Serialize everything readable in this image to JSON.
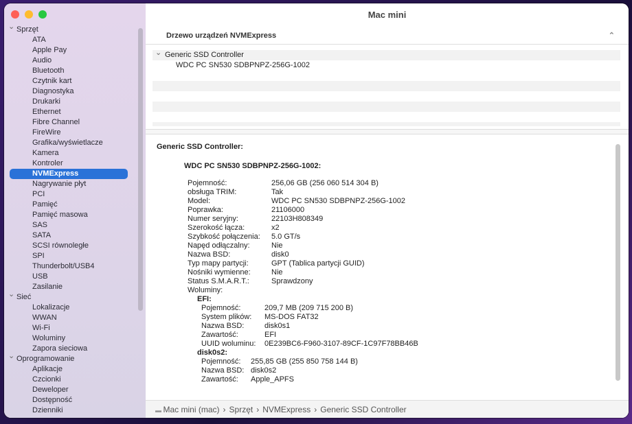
{
  "window": {
    "title": "Mac mini"
  },
  "sidebar": {
    "groups": [
      {
        "label": "Sprzęt",
        "items": [
          "ATA",
          "Apple Pay",
          "Audio",
          "Bluetooth",
          "Czytnik kart",
          "Diagnostyka",
          "Drukarki",
          "Ethernet",
          "Fibre Channel",
          "FireWire",
          "Grafika/wyświetlacze",
          "Kamera",
          "Kontroler",
          "NVMExpress",
          "Nagrywanie płyt",
          "PCI",
          "Pamięć",
          "Pamięć masowa",
          "SAS",
          "SATA",
          "SCSI równoległe",
          "SPI",
          "Thunderbolt/USB4",
          "USB",
          "Zasilanie"
        ]
      },
      {
        "label": "Sieć",
        "items": [
          "Lokalizacje",
          "WWAN",
          "Wi-Fi",
          "Woluminy",
          "Zapora sieciowa"
        ]
      },
      {
        "label": "Oprogramowanie",
        "items": [
          "Aplikacje",
          "Czcionki",
          "Deweloper",
          "Dostępność",
          "Dzienniki"
        ]
      }
    ],
    "selected": "NVMExpress"
  },
  "tree": {
    "header": "Drzewo urządzeń NVMExpress",
    "controller": "Generic SSD Controller",
    "device": "WDC PC SN530 SDBPNPZ-256G-1002"
  },
  "detail": {
    "title": "Generic SSD Controller:",
    "device_title": "WDC PC SN530 SDBPNPZ-256G-1002:",
    "props": [
      [
        "Pojemność:",
        "256,06 GB (256 060 514 304 B)"
      ],
      [
        "obsługa TRIM:",
        "Tak"
      ],
      [
        "Model:",
        "WDC PC SN530 SDBPNPZ-256G-1002"
      ],
      [
        "Poprawka:",
        "21106000"
      ],
      [
        "Numer seryjny:",
        "22103H808349"
      ],
      [
        "Szerokość łącza:",
        "x2"
      ],
      [
        "Szybkość połączenia:",
        "5.0 GT/s"
      ],
      [
        "Napęd odłączalny:",
        "Nie"
      ],
      [
        "Nazwa BSD:",
        "disk0"
      ],
      [
        "Typ mapy partycji:",
        "GPT (Tablica partycji GUID)"
      ],
      [
        "Nośniki wymienne:",
        "Nie"
      ],
      [
        "Status S.M.A.R.T.:",
        "Sprawdzony"
      ]
    ],
    "volumes_label": "Woluminy:",
    "volumes": [
      {
        "name": "EFI:",
        "props": [
          [
            "Pojemność:",
            "209,7 MB (209 715 200 B)"
          ],
          [
            "System plików:",
            "MS-DOS FAT32"
          ],
          [
            "Nazwa BSD:",
            "disk0s1"
          ],
          [
            "Zawartość:",
            "EFI"
          ],
          [
            "UUID woluminu:",
            "0E239BC6-F960-3107-89CF-1C97F78BB46B"
          ]
        ]
      },
      {
        "name": "disk0s2:",
        "props": [
          [
            "Pojemność:",
            "255,85 GB (255 850 758 144 B)"
          ],
          [
            "Nazwa BSD:",
            "disk0s2"
          ],
          [
            "Zawartość:",
            "Apple_APFS"
          ]
        ]
      }
    ]
  },
  "pathbar": {
    "items": [
      "Mac mini (mac)",
      "Sprzęt",
      "NVMExpress",
      "Generic SSD Controller"
    ],
    "separator": "›"
  }
}
